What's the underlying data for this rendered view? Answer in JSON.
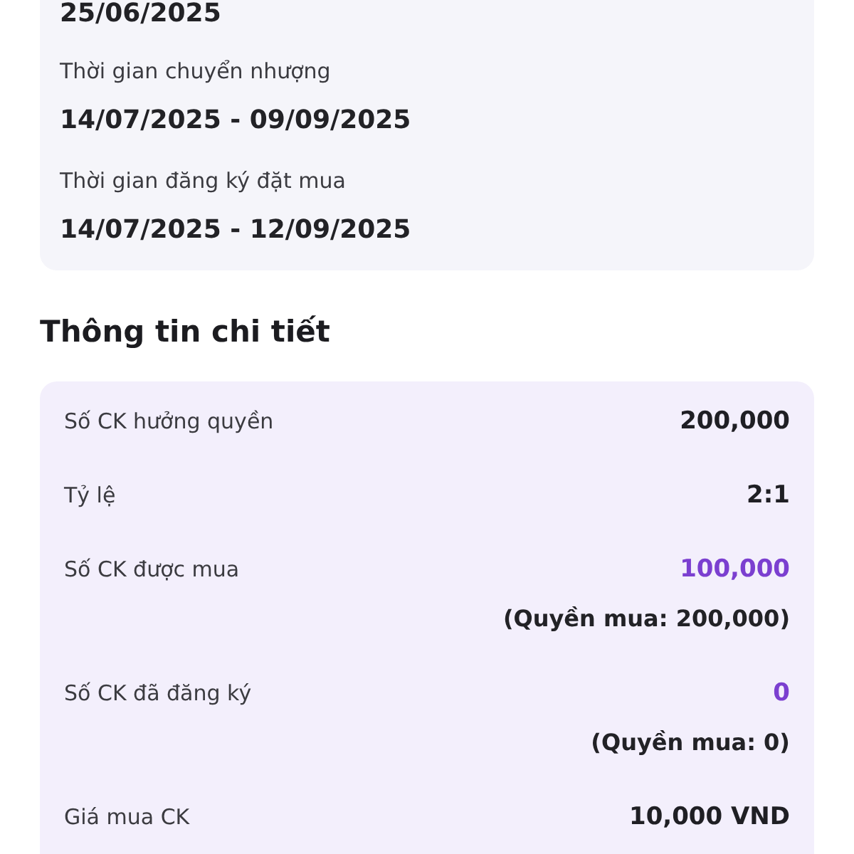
{
  "schedule_card": {
    "fields": [
      {
        "value": "25/06/2025"
      },
      {
        "label": "Thời gian chuyển nhượng",
        "value": "14/07/2025 - 09/09/2025"
      },
      {
        "label": "Thời gian đăng ký đặt mua",
        "value": "14/07/2025 - 12/09/2025"
      }
    ]
  },
  "details": {
    "title": "Thông tin chi tiết",
    "rows": [
      {
        "label": "Số CK hưởng quyền",
        "value": "200,000",
        "highlight": false
      },
      {
        "label": "Tỷ lệ",
        "value": "2:1",
        "highlight": false
      },
      {
        "label": "Số CK được mua",
        "value": "100,000",
        "highlight": true,
        "note": "(Quyền mua: 200,000)"
      },
      {
        "label": "Số CK đã đăng ký",
        "value": "0",
        "highlight": true,
        "note": "(Quyền mua: 0)"
      },
      {
        "label": "Giá mua CK",
        "value": "10,000 VND",
        "highlight": false
      }
    ]
  }
}
